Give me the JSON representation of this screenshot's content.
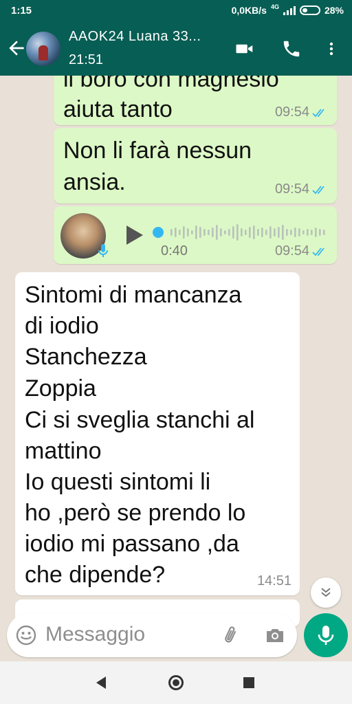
{
  "status_bar": {
    "time": "1:15",
    "network_speed": "0,0KB/s",
    "network_type": "4G",
    "battery": "28%"
  },
  "header": {
    "contact_name": "AAOK24 Luana 33...",
    "subtitle": "21:51",
    "icons": [
      "back-arrow-icon",
      "video-call-icon",
      "phone-call-icon",
      "more-vert-icon"
    ]
  },
  "messages": [
    {
      "direction": "out",
      "lines": [
        "il boro con magnesio",
        "aiuta tanto"
      ],
      "time": "09:54",
      "status": "read"
    },
    {
      "direction": "out",
      "lines": [
        "Non li farà nessun",
        "ansia."
      ],
      "time": "09:54",
      "status": "read"
    },
    {
      "direction": "out",
      "type": "voice",
      "duration": "0:40",
      "time": "09:54",
      "status": "read"
    },
    {
      "direction": "in",
      "lines": [
        "Sintomi di mancanza",
        "di iodio",
        "Stanchezza",
        "Zoppia",
        "Ci si sveglia stanchi al",
        "mattino",
        "Io questi sintomi li",
        "ho ,però se prendo lo",
        "iodio mi passano ,da",
        "che dipende?"
      ],
      "time": "14:51"
    }
  ],
  "composer": {
    "placeholder": "Messaggio"
  },
  "colors": {
    "header": "#075E54",
    "outgoing_bubble": "#dcf8c6",
    "incoming_bubble": "#ffffff",
    "read_ticks": "#34b7f1",
    "send_button": "#00a884"
  }
}
